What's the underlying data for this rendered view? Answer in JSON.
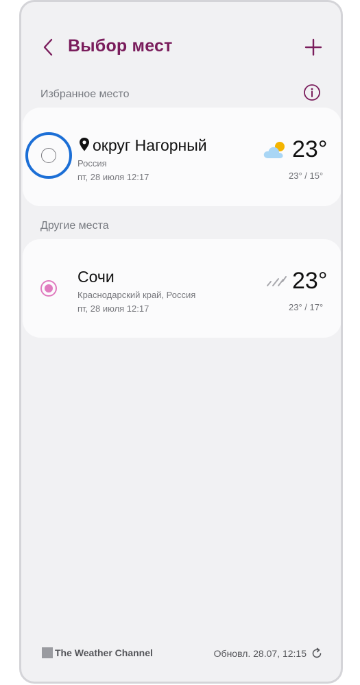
{
  "header": {
    "title": "Выбор мест"
  },
  "favorite_section": {
    "label": "Избранное место",
    "location": {
      "name": "округ Нагорный",
      "region": "Россия",
      "datetime": "пт, 28 июля 12:17",
      "temperature": "23°",
      "range": "23° / 15°",
      "weather_icon": "partly-cloudy-icon"
    }
  },
  "other_section": {
    "label": "Другие места",
    "location": {
      "name": "Сочи",
      "region": "Краснодарский край, Россия",
      "datetime": "пт, 28 июля 12:17",
      "temperature": "23°",
      "range": "23° / 17°",
      "weather_icon": "rain-icon"
    }
  },
  "footer": {
    "brand": "The Weather Channel",
    "updated": "Обновл. 28.07, 12:15"
  },
  "colors": {
    "accent": "#7a1d5c",
    "highlight": "#1c6fd6",
    "selected": "#e07bbf"
  }
}
